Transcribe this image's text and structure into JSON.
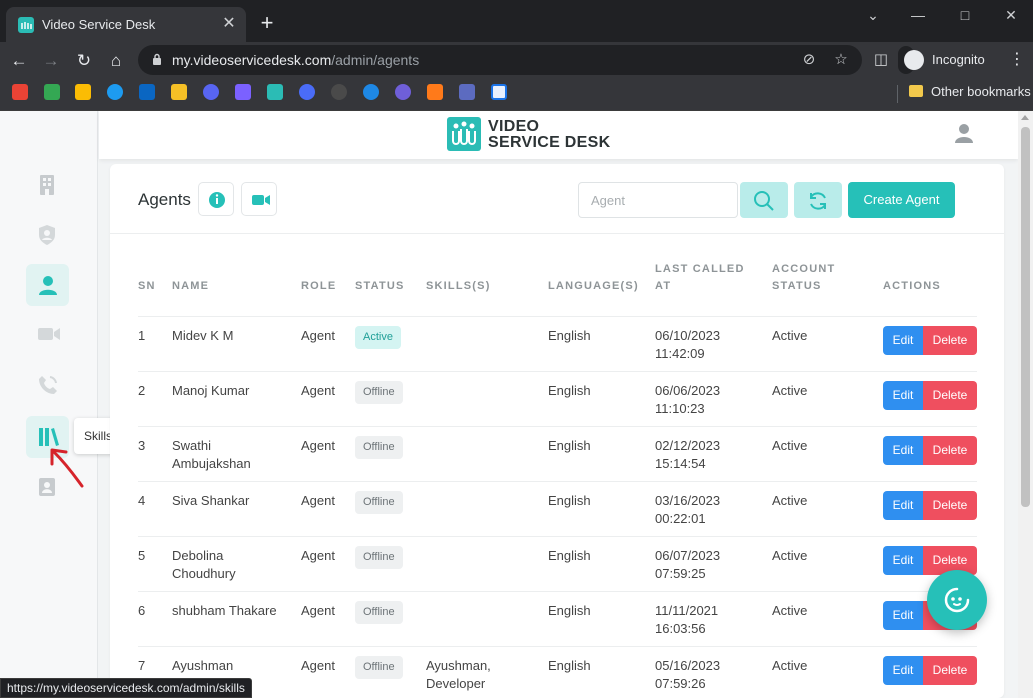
{
  "browser": {
    "tab_title": "Video Service Desk",
    "url_host": "my.videoservicedesk.com",
    "url_path": "/admin/agents",
    "profile_label": "Incognito",
    "other_bookmarks": "Other bookmarks",
    "status_url": "https://my.videoservicedesk.com/admin/skills",
    "tab_close_glyph": "✕",
    "new_tab_glyph": "+"
  },
  "app": {
    "logo_line1": "VIDEO",
    "logo_line2": "SERVICE DESK",
    "tooltip": "Skills"
  },
  "page": {
    "title": "Agents",
    "search_placeholder": "Agent",
    "create_button": "Create Agent"
  },
  "colors": {
    "brand": "#26c0b8",
    "edit": "#2f8ff0",
    "delete": "#ef4f5f"
  },
  "table": {
    "headers": [
      "SN",
      "NAME",
      "ROLE",
      "STATUS",
      "SKILLS(S)",
      "LANGUAGE(S)",
      "LAST CALLED AT",
      "ACCOUNT STATUS",
      "ACTIONS"
    ],
    "header_lines": {
      "last_called_1": "LAST CALLED",
      "last_called_2": "AT",
      "account_status_1": "ACCOUNT",
      "account_status_2": "STATUS"
    },
    "edit_label": "Edit",
    "delete_label": "Delete",
    "rows": [
      {
        "sn": "1",
        "name1": "Midev K M",
        "name2": "",
        "role": "Agent",
        "status": "Active",
        "skills1": "",
        "skills2": "",
        "language": "English",
        "date": "06/10/2023",
        "time": "11:42:09",
        "account_status": "Active"
      },
      {
        "sn": "2",
        "name1": "Manoj Kumar",
        "name2": "",
        "role": "Agent",
        "status": "Offline",
        "skills1": "",
        "skills2": "",
        "language": "English",
        "date": "06/06/2023",
        "time": "11:10:23",
        "account_status": "Active"
      },
      {
        "sn": "3",
        "name1": "Swathi",
        "name2": "Ambujakshan",
        "role": "Agent",
        "status": "Offline",
        "skills1": "",
        "skills2": "",
        "language": "English",
        "date": "02/12/2023",
        "time": "15:14:54",
        "account_status": "Active"
      },
      {
        "sn": "4",
        "name1": "Siva Shankar",
        "name2": "",
        "role": "Agent",
        "status": "Offline",
        "skills1": "",
        "skills2": "",
        "language": "English",
        "date": "03/16/2023",
        "time": "00:22:01",
        "account_status": "Active"
      },
      {
        "sn": "5",
        "name1": "Debolina",
        "name2": "Choudhury",
        "role": "Agent",
        "status": "Offline",
        "skills1": "",
        "skills2": "",
        "language": "English",
        "date": "06/07/2023",
        "time": "07:59:25",
        "account_status": "Active"
      },
      {
        "sn": "6",
        "name1": "shubham Thakare",
        "name2": "",
        "role": "Agent",
        "status": "Offline",
        "skills1": "",
        "skills2": "",
        "language": "English",
        "date": "11/11/2021",
        "time": "16:03:56",
        "account_status": "Active"
      },
      {
        "sn": "7",
        "name1": "Ayushman",
        "name2": "",
        "role": "Agent",
        "status": "Offline",
        "skills1": "Ayushman,",
        "skills2": "Developer",
        "language": "English",
        "date": "05/16/2023",
        "time": "07:59:26",
        "account_status": "Active"
      }
    ]
  }
}
